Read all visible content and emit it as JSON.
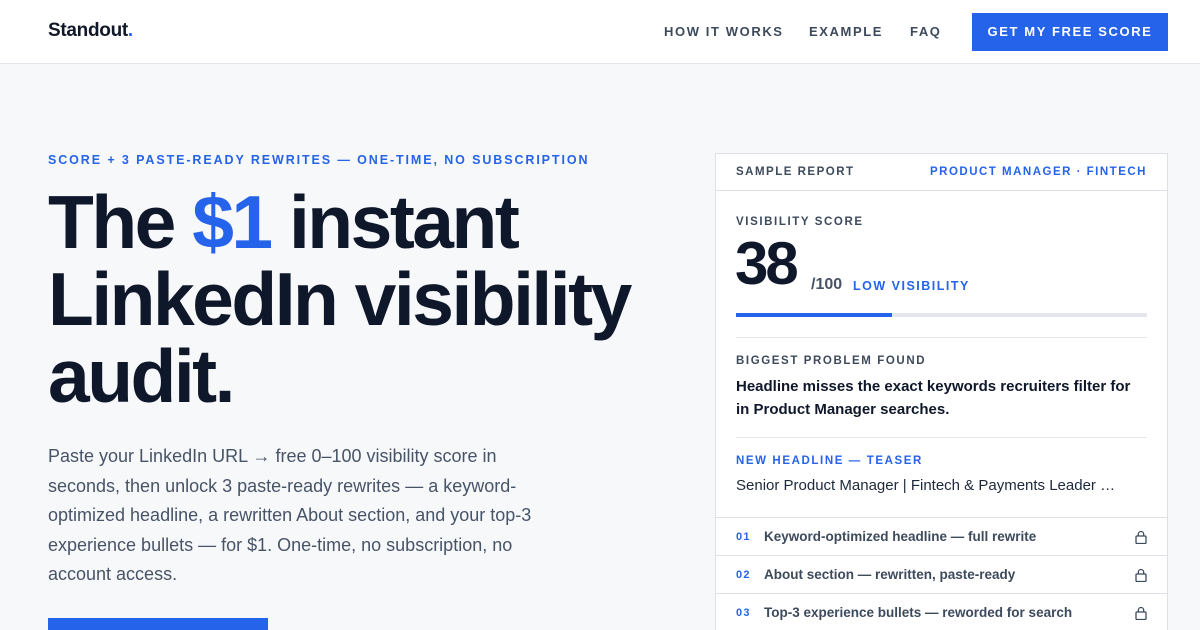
{
  "header": {
    "logo_text": "Standout",
    "logo_dot": ".",
    "nav": [
      "HOW IT WORKS",
      "EXAMPLE",
      "FAQ"
    ],
    "cta_label": "GET MY FREE SCORE"
  },
  "hero": {
    "eyebrow": "SCORE + 3 PASTE-READY REWRITES — ONE-TIME, NO SUBSCRIPTION",
    "title_pre": "The ",
    "title_accent": "$1",
    "title_post": " instant LinkedIn visibility audit.",
    "subtitle": "Paste your LinkedIn URL → free 0–100 visibility score in seconds, then unlock 3 paste-ready rewrites — a keyword-optimized headline, a rewritten About section, and your top-3 experience bullets — for $1. One-time, no subscription, no account access."
  },
  "report": {
    "label": "SAMPLE REPORT",
    "role": "PRODUCT MANAGER · FINTECH",
    "score_label": "VISIBILITY SCORE",
    "score": "38",
    "score_max": "/100",
    "score_status": "LOW VISIBILITY",
    "score_fraction": 0.38,
    "problem_label": "BIGGEST PROBLEM FOUND",
    "problem_text": "Headline misses the exact keywords recruiters filter for in Product Manager searches.",
    "teaser_label": "NEW HEADLINE — TEASER",
    "teaser_text": "Senior Product Manager | Fintech & Payments Leader …",
    "locked_items": [
      {
        "num": "01",
        "text": "Keyword-optimized headline — full rewrite",
        "icon": "lock-icon"
      },
      {
        "num": "02",
        "text": "About section — rewritten, paste-ready",
        "icon": "lock-icon"
      },
      {
        "num": "03",
        "text": "Top-3 experience bullets — reworded for search",
        "icon": "lock-icon"
      }
    ]
  },
  "colors": {
    "accent": "#2563eb",
    "text_dark": "#0f172a",
    "text_muted": "#475467",
    "background": "#f7f8fa"
  }
}
